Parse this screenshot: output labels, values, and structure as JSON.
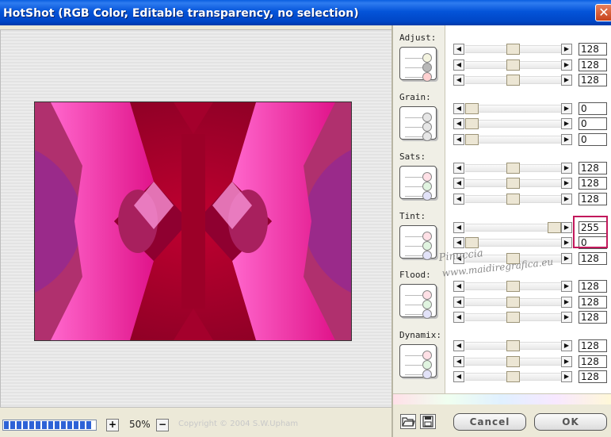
{
  "window": {
    "title": "HotShot (RGB Color, Editable transparency, no selection)",
    "close_symbol": "✕"
  },
  "preview": {
    "zoom": "50%",
    "zoom_in": "+",
    "zoom_out": "−",
    "copyright": "Copyright © 2004 S.W.Upham",
    "progress_fraction": 1.0
  },
  "categories": [
    {
      "label": "Adjust:",
      "dot_colors": [
        "#f4f4e0",
        "#b8b8b8",
        "#ffd0d0"
      ]
    },
    {
      "label": "Grain:",
      "dot_colors": [
        "#e6e6e6",
        "#e6e6e6",
        "#e6e6e6"
      ]
    },
    {
      "label": "Sats:",
      "dot_colors": [
        "#ffe0e6",
        "#e0f4e0",
        "#e2e2f8"
      ]
    },
    {
      "label": "Tint:",
      "dot_colors": [
        "#ffe0e6",
        "#e0f4e0",
        "#e2e2f8"
      ]
    },
    {
      "label": "Flood:",
      "dot_colors": [
        "#ffe0e6",
        "#e0f4e0",
        "#e2e2f8"
      ]
    },
    {
      "label": "Dynamix:",
      "dot_colors": [
        "#ffe0e6",
        "#e0f4e0",
        "#e2e2f8"
      ]
    }
  ],
  "sliders": [
    {
      "value": "128",
      "level": 0.5
    },
    {
      "value": "128",
      "level": 0.5
    },
    {
      "value": "128",
      "level": 0.5
    },
    {
      "value": "0",
      "level": 0.0
    },
    {
      "value": "0",
      "level": 0.0
    },
    {
      "value": "0",
      "level": 0.0
    },
    {
      "value": "128",
      "level": 0.5
    },
    {
      "value": "128",
      "level": 0.5
    },
    {
      "value": "128",
      "level": 0.5
    },
    {
      "value": "255",
      "level": 1.0
    },
    {
      "value": "0",
      "level": 0.0
    },
    {
      "value": "128",
      "level": 0.5
    },
    {
      "value": "128",
      "level": 0.5
    },
    {
      "value": "128",
      "level": 0.5
    },
    {
      "value": "128",
      "level": 0.5
    },
    {
      "value": "128",
      "level": 0.5
    },
    {
      "value": "128",
      "level": 0.5
    },
    {
      "value": "128",
      "level": 0.5
    }
  ],
  "watermark": {
    "line1": "Pinuccia",
    "line2": "www.maidiregrafica.eu"
  },
  "buttons": {
    "cancel": "Cancel",
    "ok": "OK"
  },
  "colors": {
    "title_bar": "#0454d9",
    "highlight": "#c2185b",
    "image_magenta": "#e0148a",
    "image_crimson": "#a8002a"
  }
}
